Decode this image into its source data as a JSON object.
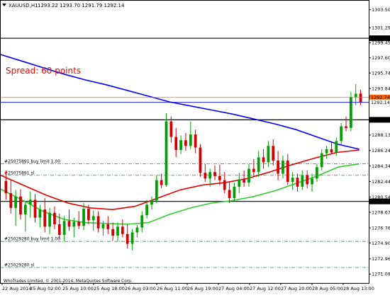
{
  "header": {
    "symbol_timeframe": "XAUUSD,H1",
    "ohlc": "1293.22 1293.70 1291.79 1292.14",
    "dropdown_icon": "triangle-down-icon"
  },
  "spread_label": "Spread: 60 points",
  "copyright": "WhoTrades Limited, © 2001-2014, MetaQuotes Software Corp.",
  "colors": {
    "bull": "#00a000",
    "bear": "#d00000",
    "ma_blue": "#0000ff",
    "ma_red": "#e00000",
    "ma_green": "#33cc33",
    "spread_text": "#ff0000",
    "bid_line": "#0000cc",
    "ask_line": "#ff6600",
    "level_line": "#000000",
    "order_line": "#2e8b57"
  },
  "price_axis": {
    "ticks": [
      "1303.50",
      "1301.29",
      "1299.45",
      "1297.60",
      "1295.74",
      "1293.84",
      "1290.00",
      "1288.13",
      "1286.24",
      "1284.34",
      "1282.44",
      "1280.54",
      "1278.67",
      "1276.76",
      "1274.90",
      "1272.96",
      "1271.09"
    ],
    "labels": {
      "level_1300": "1300.00",
      "ask": "1292.74",
      "bid": "1292.14",
      "level_1290": "1290.00",
      "level_1280": "1280.00"
    }
  },
  "time_axis": [
    "22 Aug 2014",
    "25 Aug 02:00",
    "25 Aug 10:00",
    "25 Aug 18:00",
    "26 Aug 03:00",
    "26 Aug 11:00",
    "26 Aug 19:00",
    "27 Aug 04:00",
    "27 Aug 12:00",
    "27 Aug 20:00",
    "28 Aug 05:00",
    "28 Aug 13:00"
  ],
  "orders": [
    {
      "label": "#25075891 buy limit 1.00",
      "price": 1284.6
    },
    {
      "label": "#25075891 sl",
      "price": 1283.2
    },
    {
      "label": "#25029280 buy limit 1.00",
      "price": 1275.1
    },
    {
      "label": "#25029280 sl",
      "price": 1271.9
    }
  ],
  "chart_data": {
    "type": "candlestick",
    "symbol": "XAUUSD",
    "timeframe": "H1",
    "ylim": [
      1270.0,
      1304.6
    ],
    "levels": [
      1300.0,
      1290.0,
      1280.0
    ],
    "ask": 1292.74,
    "bid": 1292.14,
    "candles": [
      [
        1282.5,
        1283.8,
        1280.2,
        1281.0
      ],
      [
        1281.0,
        1282.6,
        1278.5,
        1279.2
      ],
      [
        1279.2,
        1281.4,
        1277.0,
        1280.6
      ],
      [
        1280.6,
        1281.5,
        1277.8,
        1278.4
      ],
      [
        1278.4,
        1280.0,
        1276.3,
        1279.6
      ],
      [
        1279.6,
        1281.2,
        1278.0,
        1280.2
      ],
      [
        1280.2,
        1280.9,
        1277.4,
        1278.0
      ],
      [
        1278.0,
        1279.6,
        1276.8,
        1279.0
      ],
      [
        1279.0,
        1280.4,
        1276.2,
        1276.9
      ],
      [
        1276.9,
        1279.2,
        1276.0,
        1278.6
      ],
      [
        1278.6,
        1279.4,
        1276.6,
        1277.2
      ],
      [
        1277.2,
        1278.5,
        1275.4,
        1275.9
      ],
      [
        1275.9,
        1278.2,
        1275.1,
        1277.6
      ],
      [
        1277.6,
        1279.0,
        1276.4,
        1276.9
      ],
      [
        1276.9,
        1278.0,
        1275.6,
        1277.5
      ],
      [
        1277.5,
        1278.8,
        1276.6,
        1277.0
      ],
      [
        1277.0,
        1279.8,
        1276.5,
        1279.1
      ],
      [
        1279.1,
        1279.6,
        1277.2,
        1277.7
      ],
      [
        1277.7,
        1278.9,
        1276.4,
        1278.2
      ],
      [
        1278.2,
        1278.8,
        1276.2,
        1276.7
      ],
      [
        1276.7,
        1277.6,
        1275.8,
        1277.2
      ],
      [
        1277.2,
        1278.2,
        1276.0,
        1276.6
      ],
      [
        1276.6,
        1277.4,
        1275.2,
        1275.8
      ],
      [
        1275.8,
        1277.4,
        1275.1,
        1276.9
      ],
      [
        1276.9,
        1277.8,
        1275.6,
        1276.0
      ],
      [
        1276.0,
        1277.2,
        1274.2,
        1274.8
      ],
      [
        1274.8,
        1276.6,
        1274.0,
        1276.2
      ],
      [
        1276.2,
        1277.1,
        1275.6,
        1276.8
      ],
      [
        1276.8,
        1278.8,
        1276.2,
        1278.3
      ],
      [
        1278.3,
        1280.2,
        1277.9,
        1279.6
      ],
      [
        1279.6,
        1280.6,
        1279.0,
        1280.1
      ],
      [
        1280.1,
        1283.2,
        1279.8,
        1282.6
      ],
      [
        1282.6,
        1283.4,
        1281.6,
        1282.0
      ],
      [
        1282.0,
        1290.8,
        1281.8,
        1289.8
      ],
      [
        1289.8,
        1290.4,
        1287.2,
        1287.9
      ],
      [
        1287.9,
        1289.0,
        1285.4,
        1286.3
      ],
      [
        1286.3,
        1288.1,
        1285.8,
        1287.5
      ],
      [
        1287.5,
        1288.4,
        1286.2,
        1286.8
      ],
      [
        1286.8,
        1289.8,
        1286.4,
        1288.2
      ],
      [
        1288.2,
        1288.8,
        1285.9,
        1286.6
      ],
      [
        1286.6,
        1287.0,
        1283.0,
        1283.5
      ],
      [
        1283.5,
        1284.6,
        1282.4,
        1282.8
      ],
      [
        1282.8,
        1284.0,
        1281.8,
        1283.6
      ],
      [
        1283.6,
        1284.4,
        1282.6,
        1283.1
      ],
      [
        1283.1,
        1284.5,
        1282.0,
        1282.6
      ],
      [
        1282.6,
        1283.6,
        1281.0,
        1281.4
      ],
      [
        1281.4,
        1282.4,
        1279.8,
        1280.4
      ],
      [
        1280.4,
        1282.3,
        1280.0,
        1281.8
      ],
      [
        1281.8,
        1283.5,
        1281.0,
        1282.7
      ],
      [
        1282.7,
        1283.8,
        1281.8,
        1282.3
      ],
      [
        1282.3,
        1284.6,
        1281.8,
        1284.0
      ],
      [
        1284.0,
        1285.2,
        1283.0,
        1283.6
      ],
      [
        1283.6,
        1286.2,
        1283.0,
        1285.4
      ],
      [
        1285.4,
        1286.4,
        1284.0,
        1284.8
      ],
      [
        1284.8,
        1287.4,
        1284.2,
        1286.8
      ],
      [
        1286.8,
        1287.6,
        1284.4,
        1285.0
      ],
      [
        1285.0,
        1286.2,
        1282.6,
        1283.4
      ],
      [
        1283.4,
        1285.6,
        1282.8,
        1285.0
      ],
      [
        1285.0,
        1285.8,
        1282.0,
        1282.4
      ],
      [
        1282.4,
        1283.6,
        1281.4,
        1282.9
      ],
      [
        1282.9,
        1283.4,
        1281.2,
        1281.8
      ],
      [
        1281.8,
        1283.8,
        1281.4,
        1283.2
      ],
      [
        1283.2,
        1283.8,
        1281.6,
        1282.1
      ],
      [
        1282.1,
        1283.4,
        1281.2,
        1282.8
      ],
      [
        1282.8,
        1284.6,
        1282.4,
        1284.2
      ],
      [
        1284.2,
        1286.4,
        1283.8,
        1285.9
      ],
      [
        1285.9,
        1286.8,
        1285.2,
        1286.4
      ],
      [
        1286.4,
        1287.2,
        1285.8,
        1286.0
      ],
      [
        1286.0,
        1287.8,
        1285.6,
        1287.4
      ],
      [
        1287.4,
        1289.6,
        1287.0,
        1289.2
      ],
      [
        1289.2,
        1290.4,
        1288.6,
        1289.0
      ],
      [
        1289.0,
        1293.4,
        1288.6,
        1292.8
      ],
      [
        1292.8,
        1294.4,
        1291.8,
        1293.2
      ],
      [
        1293.22,
        1293.7,
        1291.79,
        1292.14
      ]
    ],
    "moving_averages": [
      {
        "period_style": "long",
        "color": "blue",
        "points": [
          1298.0,
          1297.2,
          1296.4,
          1295.6,
          1294.9,
          1294.3,
          1293.6,
          1292.9,
          1292.2,
          1291.7,
          1291.2,
          1290.7,
          1290.1,
          1289.5,
          1288.8,
          1287.9,
          1287.0,
          1286.4
        ]
      },
      {
        "period_style": "medium",
        "color": "red",
        "points": [
          1283.2,
          1282.0,
          1280.8,
          1279.8,
          1279.2,
          1279.0,
          1279.4,
          1280.4,
          1281.4,
          1282.0,
          1282.3,
          1282.8,
          1283.6,
          1284.5,
          1285.3,
          1286.0,
          1286.3
        ]
      },
      {
        "period_style": "short",
        "color": "green",
        "points": [
          1281.5,
          1280.2,
          1278.8,
          1277.8,
          1277.4,
          1277.3,
          1277.2,
          1277.4,
          1278.4,
          1279.2,
          1279.8,
          1280.1,
          1280.6,
          1281.3,
          1282.2,
          1283.1,
          1284.2,
          1284.6
        ]
      }
    ]
  }
}
